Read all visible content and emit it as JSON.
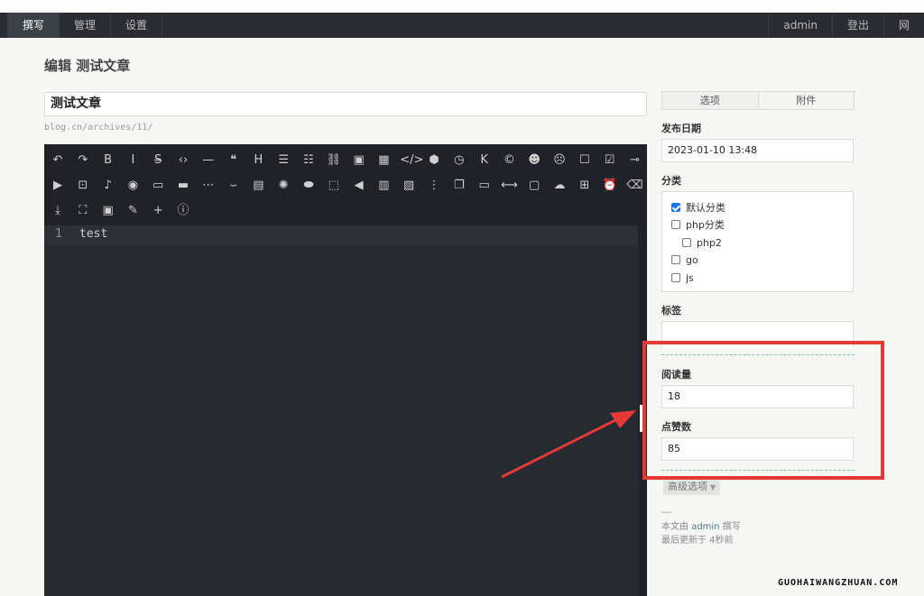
{
  "nav": {
    "left": [
      {
        "label": "撰写",
        "active": true
      },
      {
        "label": "管理",
        "active": false
      },
      {
        "label": "设置",
        "active": false
      }
    ],
    "right": [
      {
        "label": "admin"
      },
      {
        "label": "登出"
      },
      {
        "label": "网"
      }
    ]
  },
  "page": {
    "title": "编辑 测试文章",
    "post_title": "测试文章",
    "slug": "blog.cn/archives/11/"
  },
  "editor": {
    "toolbar_row1": [
      "undo-icon",
      "redo-icon",
      "bold-icon",
      "italic-icon",
      "strikethrough-icon",
      "code-inline-icon",
      "hr-icon",
      "quote-icon",
      "heading-icon",
      "ordered-list-icon",
      "unordered-list-icon",
      "link-icon",
      "image-icon",
      "table-icon",
      "code-block-icon",
      "html5-icon",
      "clock-icon",
      "kbd-icon",
      "copyright-icon",
      "emoji-icon",
      "sad-icon",
      "checkbox-icon",
      "checkbox-checked-icon",
      "commit-icon"
    ],
    "toolbar_row2": [
      "video-icon",
      "bilibili-icon",
      "music-icon",
      "netease-icon",
      "button-icon",
      "card-icon",
      "dots-icon",
      "hide-icon",
      "text-box-icon",
      "bulb-icon",
      "toggle-icon",
      "dashed-box-icon",
      "speaker-icon",
      "layout-icon",
      "note-icon",
      "timeline-icon",
      "copy-icon",
      "folder-icon",
      "divider-icon",
      "window-icon",
      "cloud-icon",
      "grid-icon",
      "alarm-icon",
      "eraser-icon"
    ],
    "toolbar_row3": [
      "download-icon",
      "fullscreen-icon",
      "preview-icon",
      "pen-icon",
      "plus-icon",
      "info-icon"
    ],
    "line_number": "1",
    "content": "test"
  },
  "sidebar": {
    "tabs": [
      {
        "label": "选项",
        "active": true
      },
      {
        "label": "附件",
        "active": false
      }
    ],
    "publish_date_label": "发布日期",
    "publish_date": "2023-01-10 13:48",
    "category_label": "分类",
    "categories": [
      {
        "label": "默认分类",
        "checked": true,
        "indent": 0
      },
      {
        "label": "php分类",
        "checked": false,
        "indent": 0
      },
      {
        "label": "php2",
        "checked": false,
        "indent": 1
      },
      {
        "label": "go",
        "checked": false,
        "indent": 0
      },
      {
        "label": "js",
        "checked": false,
        "indent": 0
      }
    ],
    "tags_label": "标签",
    "views_label": "阅读量",
    "views": "18",
    "likes_label": "点赞数",
    "likes": "85",
    "advanced_label": "高级选项",
    "dash": "—",
    "meta_prefix": "本文由",
    "meta_author": "admin",
    "meta_suffix": "撰写",
    "meta_updated": "最后更新于 4秒前"
  },
  "watermark": "GUOHAIWANGZHUAN.COM",
  "colors": {
    "navbar": "#292d33",
    "editor_bg": "#1f2228",
    "annotation": "#e53935",
    "dashed_accent": "#6fc6b4"
  }
}
